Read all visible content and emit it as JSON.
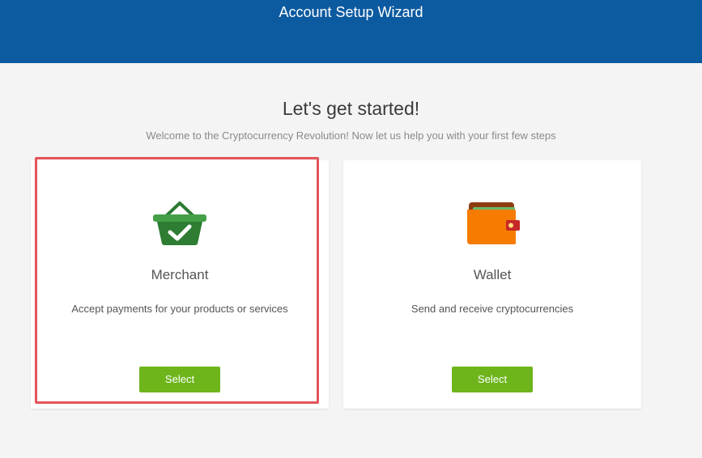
{
  "header": {
    "title": "Account Setup Wizard",
    "background_color": "#0c5aa0"
  },
  "intro": {
    "title": "Let's get started!",
    "subtitle": "Welcome to the Cryptocurrency Revolution! Now let us help you with your first few steps"
  },
  "options": [
    {
      "id": "merchant",
      "icon": "basket-check-icon",
      "name": "Merchant",
      "description": "Accept payments for your products or services",
      "button_label": "Select",
      "highlighted": true
    },
    {
      "id": "wallet",
      "icon": "wallet-icon",
      "name": "Wallet",
      "description": "Send and receive cryptocurrencies",
      "button_label": "Select",
      "highlighted": false
    }
  ],
  "colors": {
    "accent_button": "#6eb51c",
    "highlight_border": "#e2555a",
    "merchant_icon": "#2e8b3a",
    "wallet_icon": "#f57c00"
  }
}
